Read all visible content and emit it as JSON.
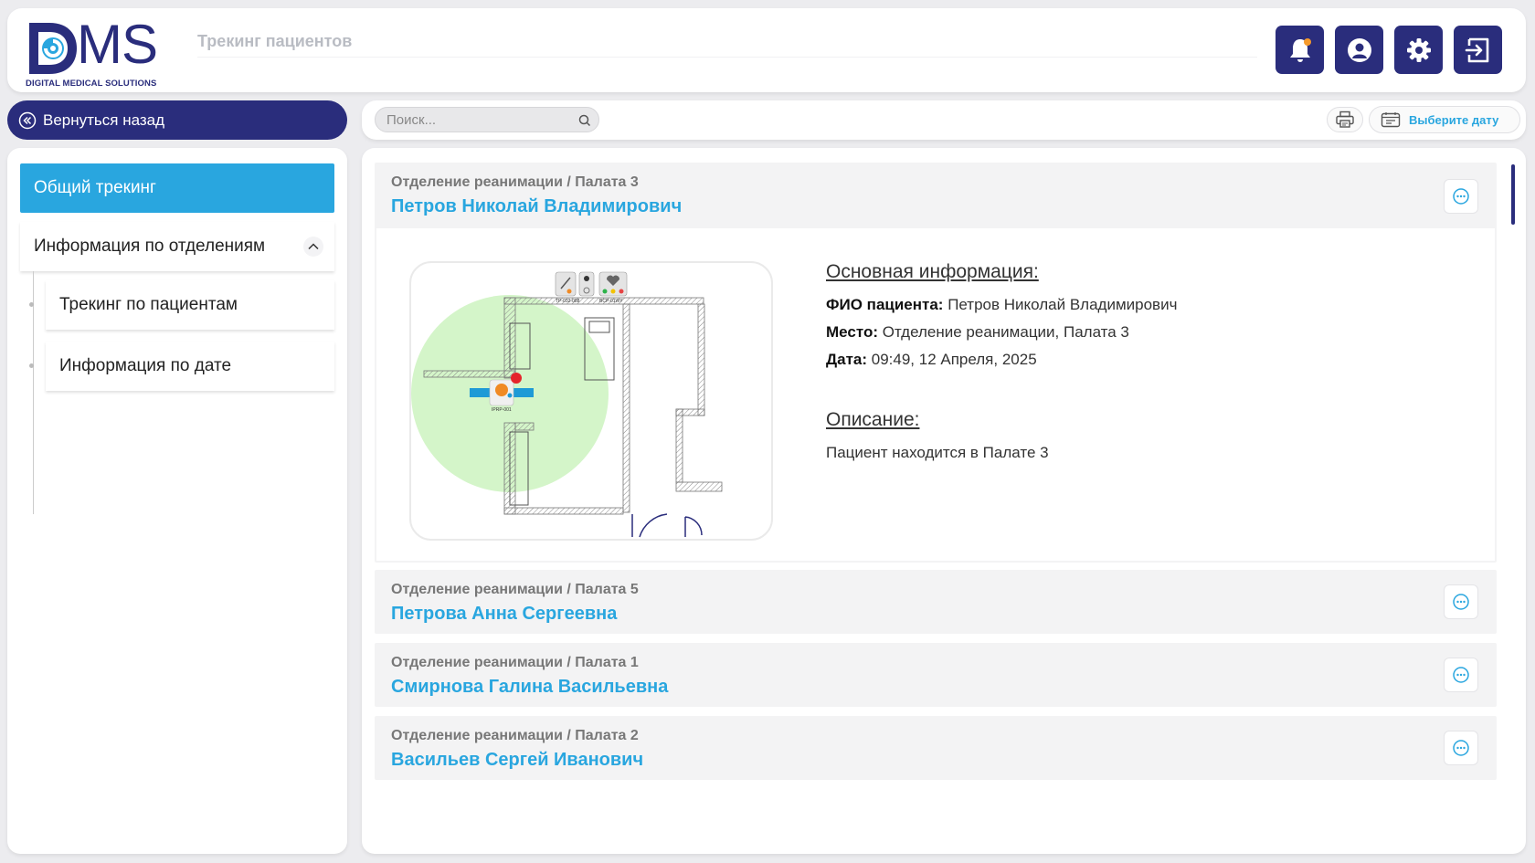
{
  "app": {
    "logo_text": "MS",
    "logo_subtitle": "DIGITAL MEDICAL SOLUTIONS",
    "page_title": "Трекинг пациентов"
  },
  "header_buttons": [
    {
      "icon": "bell-icon"
    },
    {
      "icon": "user-icon"
    },
    {
      "icon": "gear-icon"
    },
    {
      "icon": "logout-icon"
    }
  ],
  "toolbar": {
    "back_label": "Вернуться назад",
    "search_placeholder": "Поиск...",
    "date_label": "Выберите дату"
  },
  "sidebar": {
    "active_item": "Общий трекинг",
    "group_label": "Информация по отделениям",
    "sub_items": [
      "Трекинг по пациентам",
      "Информация по дате"
    ]
  },
  "patients": [
    {
      "location": "Отделение реанимации / Палата 3",
      "name": "Петров Николай Владимирович",
      "expanded": true
    },
    {
      "location": "Отделение реанимации / Палата 5",
      "name": "Петрова Анна Сергеевна",
      "expanded": false
    },
    {
      "location": "Отделение реанимации / Палата 1",
      "name": "Смирнова Галина Васильевна",
      "expanded": false
    },
    {
      "location": "Отделение реанимации / Палата 2",
      "name": "Васильев Сергей Иванович",
      "expanded": false
    }
  ],
  "details": {
    "basic_heading": "Основная информация:",
    "fio_label": "ФИО пациента:",
    "fio_value": "Петров Николай Владимирович",
    "place_label": "Место:",
    "place_value": "Отделение реанимации, Палата 3",
    "date_label": "Дата:",
    "date_value": "09:49, 12 Апреля, 2025",
    "description_heading": "Описание:",
    "description_text": "Пациент находится в Палате 3"
  },
  "map": {
    "device_labels": [
      "TP-032-088",
      "BCP-01WY",
      "IPRP-001"
    ]
  },
  "colors": {
    "brand_dark": "#2a2d7c",
    "accent": "#29a6df",
    "zone": "#d4f5c9"
  }
}
